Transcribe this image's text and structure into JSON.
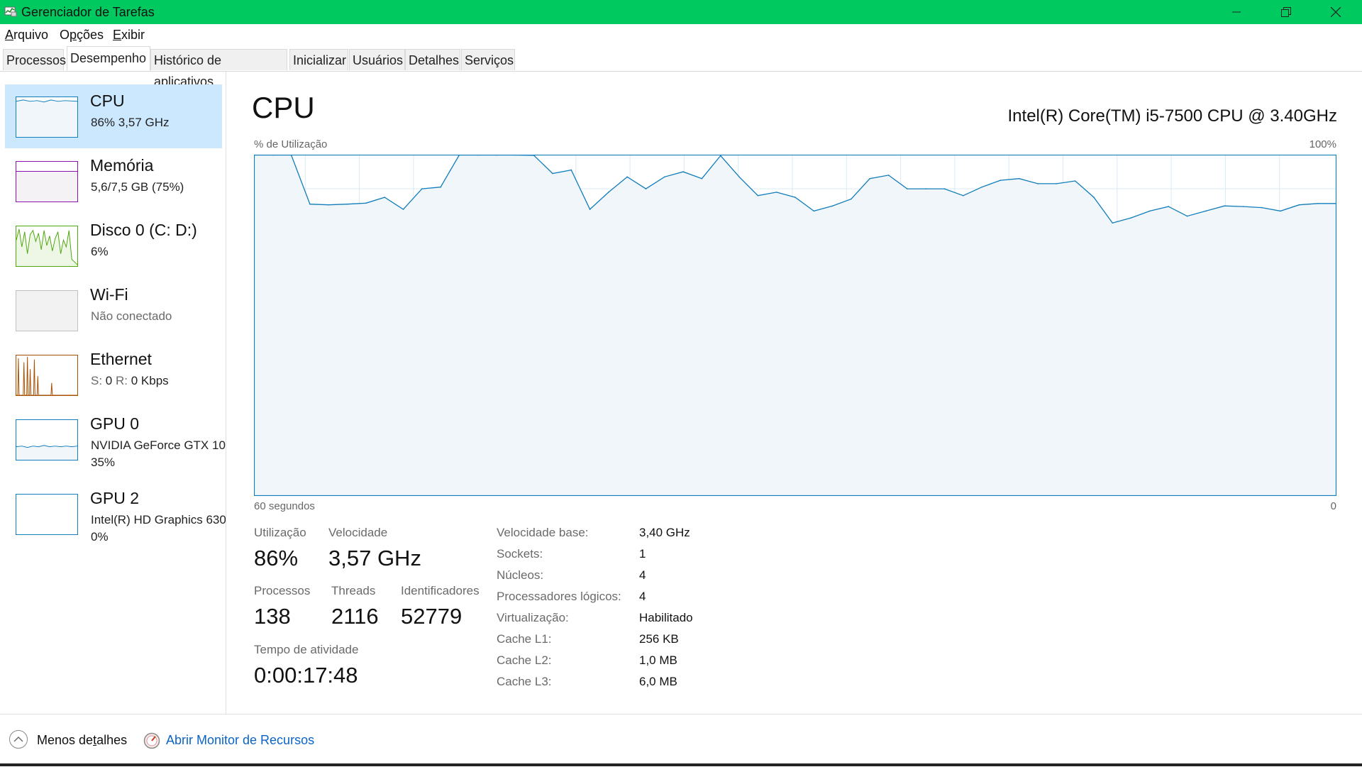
{
  "window": {
    "title": "Gerenciador de Tarefas",
    "titlebar_color": "#00c960",
    "icons": {
      "app": "task-manager-icon",
      "minimize": "minimize-icon",
      "maximize": "restore-icon",
      "close": "close-icon"
    }
  },
  "menu": [
    {
      "label": "Arquivo",
      "mnemonic": "A"
    },
    {
      "label": "Opções",
      "mnemonic": "p"
    },
    {
      "label": "Exibir",
      "mnemonic": "E"
    }
  ],
  "tabs": [
    "Processos",
    "Desempenho",
    "Histórico de aplicativos",
    "Inicializar",
    "Usuários",
    "Detalhes",
    "Serviços"
  ],
  "active_tab": "Desempenho",
  "sidebar": {
    "items": [
      {
        "name": "CPU",
        "sub": "86%  3,57 GHz",
        "selected": true,
        "color": "#117dbb"
      },
      {
        "name": "Memória",
        "sub": "5,6/7,5 GB (75%)",
        "color": "#8b12ae"
      },
      {
        "name": "Disco 0 (C: D:)",
        "sub": "6%",
        "color": "#4da60c"
      },
      {
        "name": "Wi-Fi",
        "sub": "Não conectado",
        "color": "#c0c0c0"
      },
      {
        "name": "Ethernet",
        "sub_prefix_s": "S:",
        "sub_s_value": "0",
        "sub_prefix_r": "R:",
        "sub_r_value": "0 Kbps",
        "color": "#a74f01"
      },
      {
        "name": "GPU 0",
        "sub": "NVIDIA GeForce GTX 10",
        "sub2": "35%",
        "color": "#117dbb"
      },
      {
        "name": "GPU 2",
        "sub": "Intel(R) HD Graphics 630",
        "sub2": "0%",
        "color": "#117dbb"
      }
    ]
  },
  "main": {
    "title": "CPU",
    "model": "Intel(R) Core(TM) i5-7500 CPU @ 3.40GHz",
    "graph_ylabel": "% de Utilização",
    "graph_ymax": "100%",
    "graph_xlabel_left": "60 segundos",
    "graph_xlabel_right": "0",
    "stats": {
      "utilization_label": "Utilização",
      "utilization_value": "86%",
      "speed_label": "Velocidade",
      "speed_value": "3,57 GHz",
      "processes_label": "Processos",
      "processes_value": "138",
      "threads_label": "Threads",
      "threads_value": "2116",
      "handles_label": "Identificadores",
      "handles_value": "52779",
      "uptime_label": "Tempo de atividade",
      "uptime_value": "0:00:17:48"
    },
    "info": [
      {
        "key": "Velocidade base:",
        "value": "3,40 GHz"
      },
      {
        "key": "Sockets:",
        "value": "1"
      },
      {
        "key": "Núcleos:",
        "value": "4"
      },
      {
        "key": "Processadores lógicos:",
        "value": "4"
      },
      {
        "key": "Virtualização:",
        "value": "Habilitado"
      },
      {
        "key": "Cache L1:",
        "value": "256 KB"
      },
      {
        "key": "Cache L2:",
        "value": "1,0 MB"
      },
      {
        "key": "Cache L3:",
        "value": "6,0 MB"
      }
    ]
  },
  "footer": {
    "less_details": "Menos detalhes",
    "less_details_mnemonic": "t",
    "resource_monitor": "Abrir Monitor de Recursos",
    "link_color": "#0a64c8"
  },
  "chart_data": {
    "type": "area",
    "ylim": [
      0,
      100
    ],
    "xlim": [
      60,
      0
    ],
    "grid": true,
    "values": [
      100,
      100,
      100,
      85.5,
      85.3,
      85.5,
      85.8,
      87.5,
      84,
      90,
      90.5,
      100,
      100,
      100,
      100,
      99.8,
      94.5,
      95.5,
      84,
      89,
      93.5,
      90,
      93.5,
      95,
      93,
      99.7,
      93.5,
      88,
      89,
      87.5,
      83.5,
      85,
      87,
      93,
      94,
      90,
      90,
      90,
      88,
      90.5,
      92.5,
      93,
      91.5,
      91.5,
      92.3,
      87.5,
      80,
      81.5,
      83.5,
      84.8,
      82,
      83.5,
      85,
      84.8,
      84.5,
      83.5,
      85.3,
      85.7,
      85.7
    ],
    "series_color": "#117dbb",
    "fill_color": "#f1f6fa",
    "grid_color": "#d9eaf4"
  }
}
